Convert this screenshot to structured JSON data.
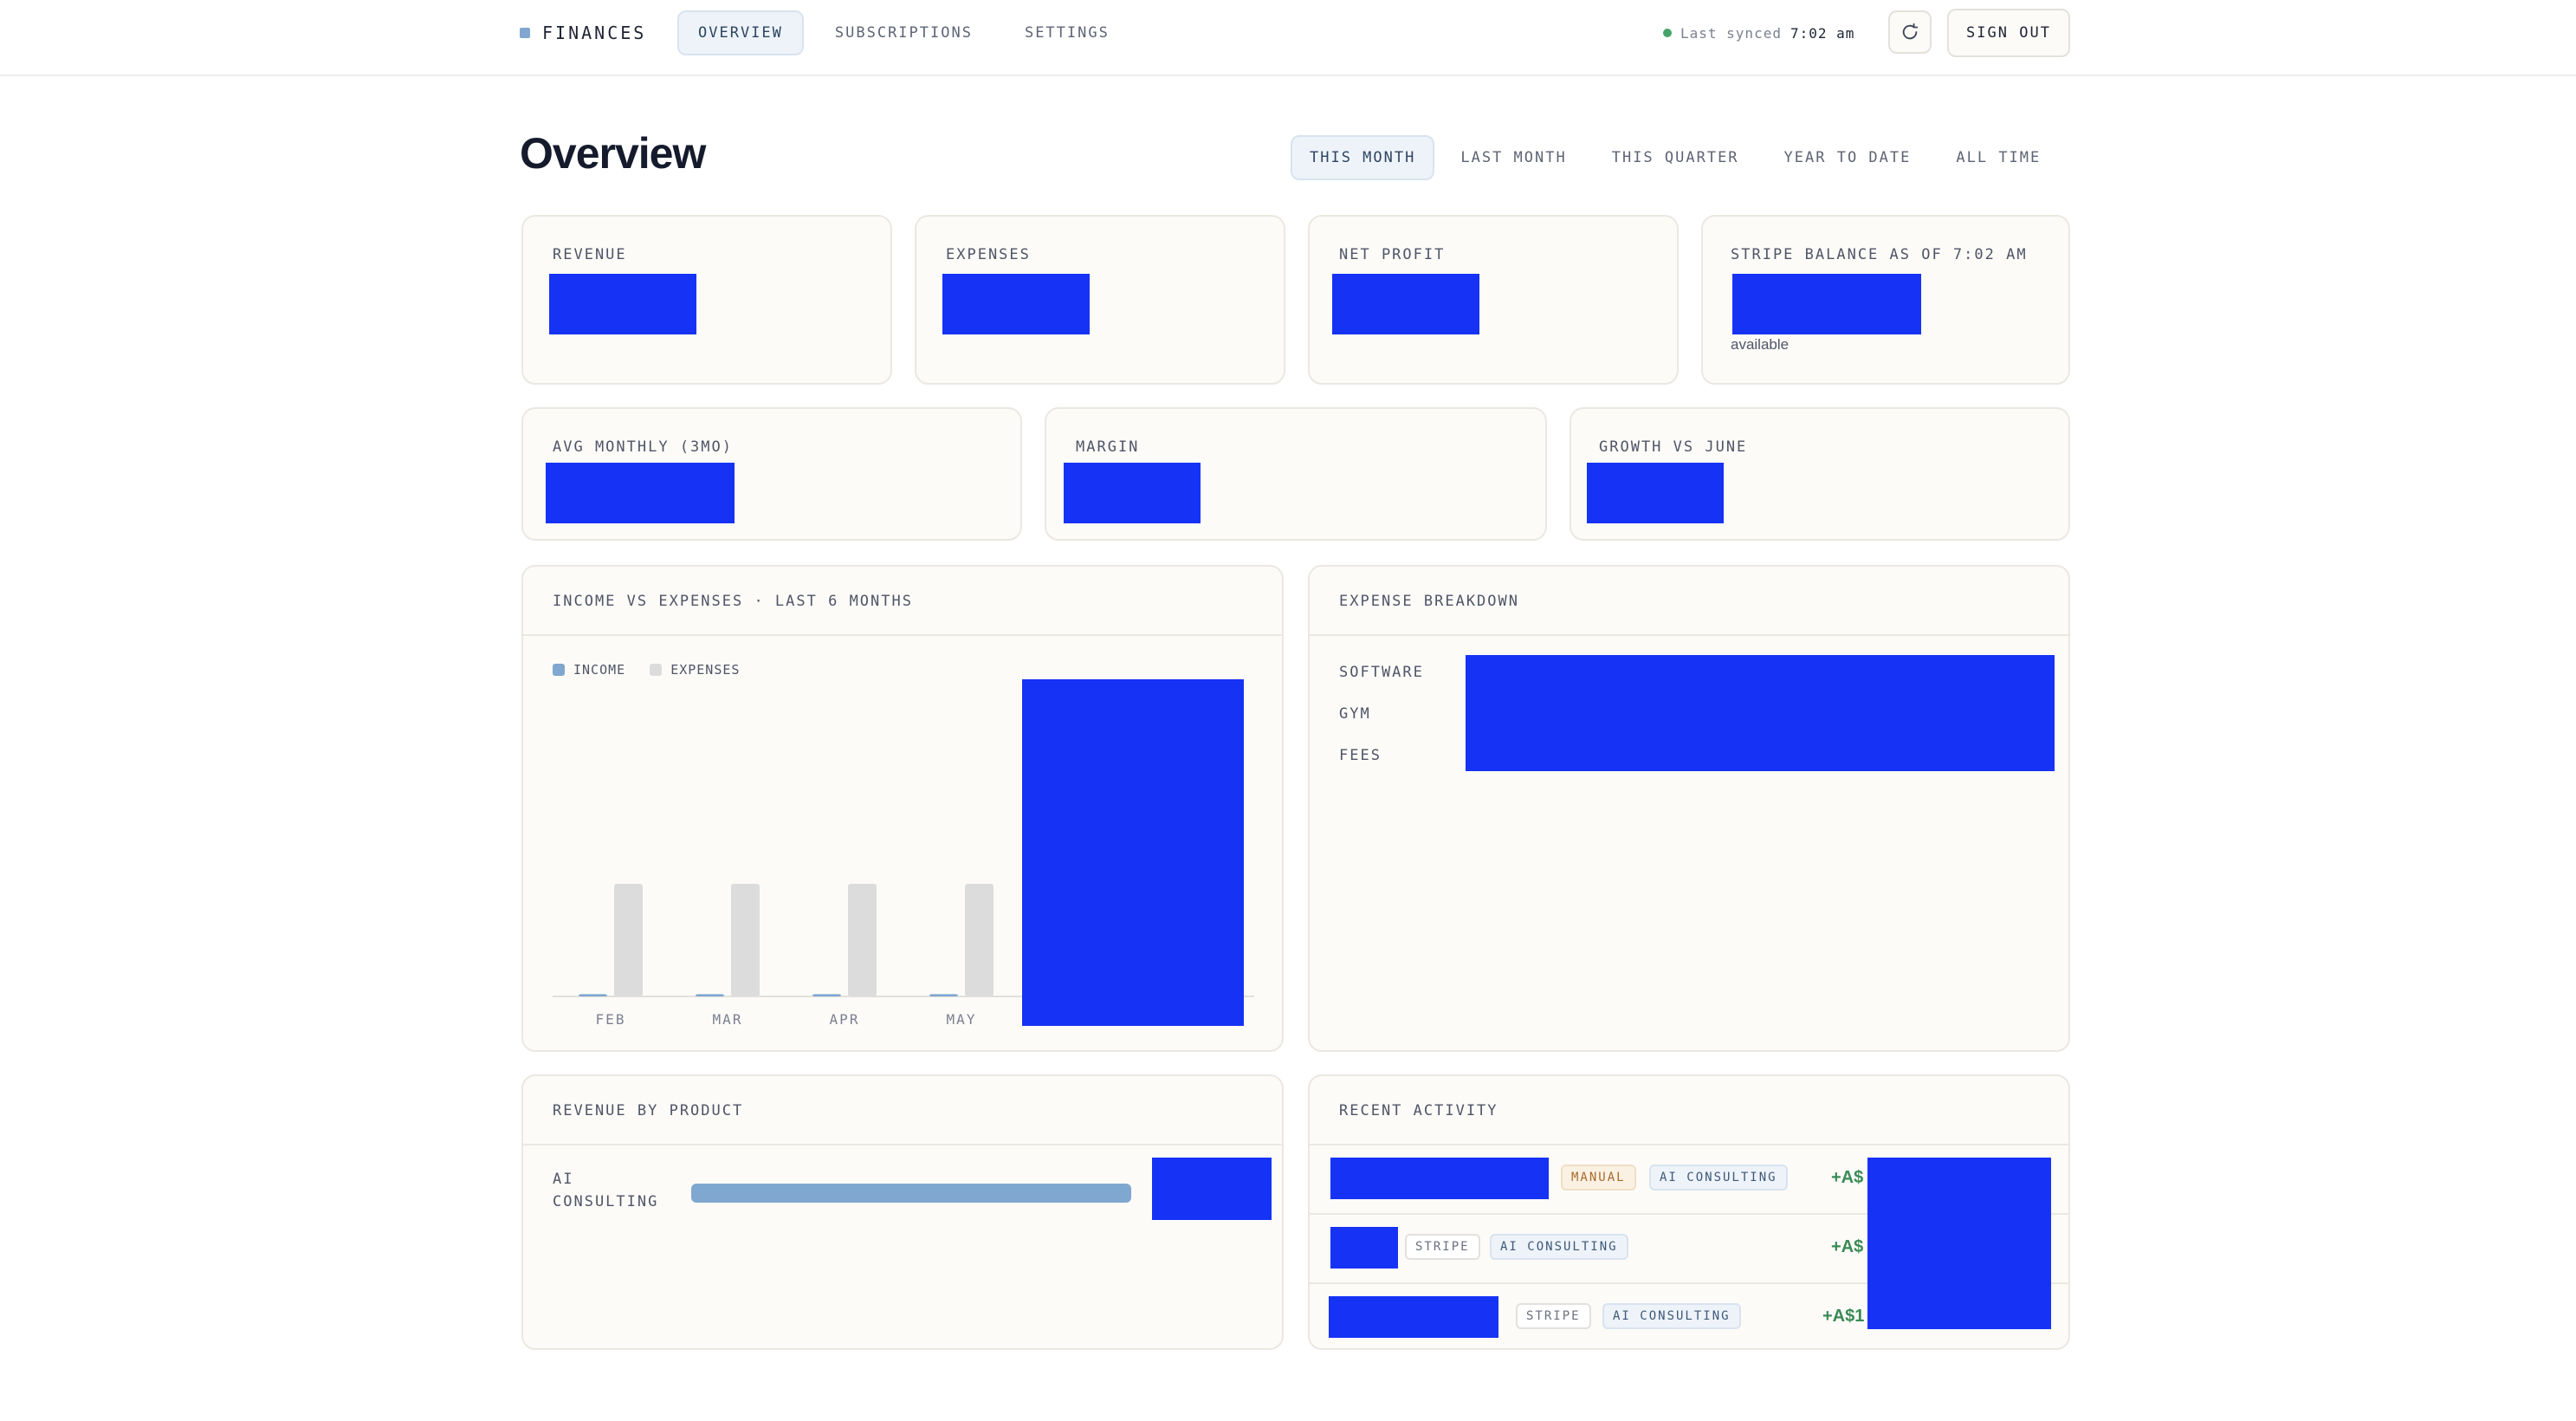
{
  "brand": {
    "label": "FINANCES"
  },
  "nav": {
    "tabs": [
      "OVERVIEW",
      "SUBSCRIPTIONS",
      "SETTINGS"
    ],
    "active": "OVERVIEW"
  },
  "sync": {
    "label": "Last synced",
    "time": "7:02 am"
  },
  "actions": {
    "refresh_icon": "refresh-icon",
    "signout_label": "SIGN OUT"
  },
  "page": {
    "title": "Overview"
  },
  "periods": {
    "options": [
      "THIS MONTH",
      "LAST MONTH",
      "THIS QUARTER",
      "YEAR TO DATE",
      "ALL TIME"
    ],
    "selected": "THIS MONTH"
  },
  "kpis": {
    "revenue": {
      "label": "REVENUE"
    },
    "expenses": {
      "label": "EXPENSES"
    },
    "net_profit": {
      "label": "NET PROFIT"
    },
    "stripe_balance": {
      "label": "STRIPE BALANCE AS OF 7:02 AM",
      "sub": "available"
    },
    "avg_monthly": {
      "label": "AVG MONTHLY (3MO)"
    },
    "margin": {
      "label": "MARGIN"
    },
    "growth": {
      "label": "GROWTH VS JUNE"
    }
  },
  "income_chart": {
    "title": "INCOME VS EXPENSES · LAST 6 MONTHS",
    "legend": {
      "income": "INCOME",
      "expenses": "EXPENSES"
    },
    "months": [
      "FEB",
      "MAR",
      "APR",
      "MAY"
    ]
  },
  "chart_data": {
    "type": "bar",
    "categories": [
      "FEB",
      "MAR",
      "APR",
      "MAY"
    ],
    "series": [
      {
        "name": "INCOME",
        "values": [
          2,
          2,
          2,
          2
        ]
      },
      {
        "name": "EXPENSES",
        "values": [
          100,
          100,
          100,
          100
        ]
      }
    ],
    "colors": {
      "INCOME": "#7fa7cf",
      "EXPENSES": "#dcdcdc"
    },
    "ylim": [
      0,
      100
    ],
    "grid": false,
    "legend_position": "top-left"
  },
  "expense_breakdown": {
    "title": "EXPENSE BREAKDOWN",
    "categories": [
      "SOFTWARE",
      "GYM",
      "FEES"
    ]
  },
  "revenue_by_product": {
    "title": "REVENUE BY PRODUCT",
    "product": "AI CONSULTING",
    "share": 1.0
  },
  "recent_activity": {
    "title": "RECENT ACTIVITY",
    "rows": [
      {
        "source": "MANUAL",
        "product": "AI CONSULTING",
        "amount": "+A$"
      },
      {
        "source": "STRIPE",
        "product": "AI CONSULTING",
        "amount": "+A$"
      },
      {
        "source": "STRIPE",
        "product": "AI CONSULTING",
        "amount": "+A$1"
      }
    ]
  },
  "colors": {
    "accent": "#7fa7cf",
    "redaction": "#1632f5",
    "positive": "#3a8a55",
    "sync_status": "#45a36a"
  }
}
